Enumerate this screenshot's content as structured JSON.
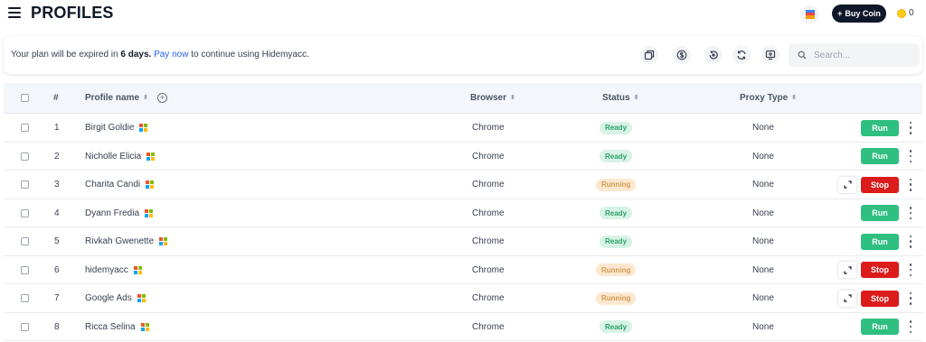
{
  "header": {
    "title": "PROFILES",
    "buy_coin_label": "Buy Coin",
    "buy_coin_icon": "plus-icon",
    "coin_count": "0"
  },
  "notice": {
    "prefix": "Your plan will be expired in ",
    "days": "6 days.",
    "link": "Pay now",
    "suffix": " to continue using Hidemyacc."
  },
  "toolbar": {
    "icons": [
      "copy-icon",
      "dollar-icon",
      "restore-icon",
      "refresh-icon",
      "screen-icon"
    ],
    "search_placeholder": "Search..."
  },
  "table": {
    "columns": {
      "index": "#",
      "name": "Profile name",
      "browser": "Browser",
      "status": "Status",
      "proxy": "Proxy Type"
    },
    "rows": [
      {
        "index": "1",
        "name": "Birgit Goldie",
        "browser": "Chrome",
        "status": "Ready",
        "proxy": "None",
        "action": "Run"
      },
      {
        "index": "2",
        "name": "Nicholle Elicia",
        "browser": "Chrome",
        "status": "Ready",
        "proxy": "None",
        "action": "Run"
      },
      {
        "index": "3",
        "name": "Charita Candi",
        "browser": "Chrome",
        "status": "Running",
        "proxy": "None",
        "action": "Stop"
      },
      {
        "index": "4",
        "name": "Dyann Fredia",
        "browser": "Chrome",
        "status": "Ready",
        "proxy": "None",
        "action": "Run"
      },
      {
        "index": "5",
        "name": "Rivkah Gwenette",
        "browser": "Chrome",
        "status": "Ready",
        "proxy": "None",
        "action": "Run"
      },
      {
        "index": "6",
        "name": "hidemyacc",
        "browser": "Chrome",
        "status": "Running",
        "proxy": "None",
        "action": "Stop"
      },
      {
        "index": "7",
        "name": "Google Ads",
        "browser": "Chrome",
        "status": "Running",
        "proxy": "None",
        "action": "Stop"
      },
      {
        "index": "8",
        "name": "Ricca Selina",
        "browser": "Chrome",
        "status": "Ready",
        "proxy": "None",
        "action": "Run"
      }
    ]
  },
  "colors": {
    "run": "#2fbf80",
    "stop": "#dc1b1b",
    "ready_bg": "#d7f3e6",
    "running_bg": "#fde8cf",
    "link": "#2563eb"
  }
}
